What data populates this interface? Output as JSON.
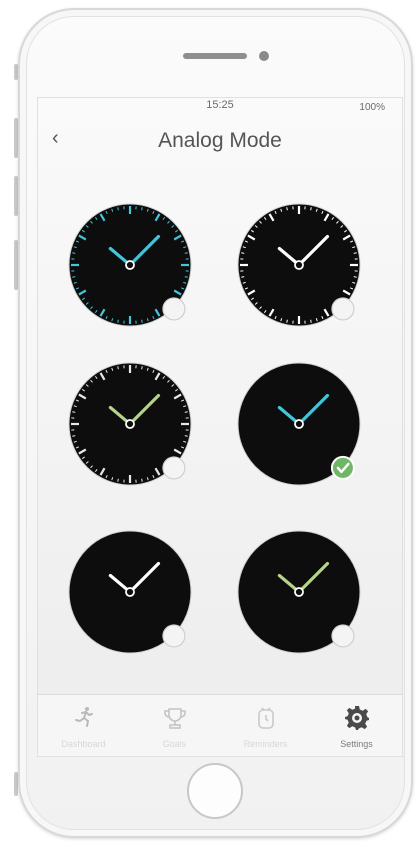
{
  "status": {
    "time": "15:25",
    "battery": "100%"
  },
  "header": {
    "back_icon": "chevron-left-icon",
    "back_glyph": "‹",
    "title": "Analog Mode"
  },
  "watch_faces": [
    {
      "name": "cyan-ticks",
      "hand_color": "#43c6dc",
      "tick_color": "#43c6dc",
      "ticks": true,
      "selected": false
    },
    {
      "name": "white-ticks",
      "hand_color": "#ffffff",
      "tick_color": "#ffffff",
      "ticks": true,
      "selected": false
    },
    {
      "name": "lime-ticks",
      "hand_color": "#b7d28a",
      "tick_color": "#e8e8e8",
      "ticks": true,
      "selected": false
    },
    {
      "name": "cyan-plain",
      "hand_color": "#43c6dc",
      "tick_color": "",
      "ticks": false,
      "selected": true
    },
    {
      "name": "white-plain",
      "hand_color": "#ffffff",
      "tick_color": "",
      "ticks": false,
      "selected": false
    },
    {
      "name": "lime-plain",
      "hand_color": "#b7d28a",
      "tick_color": "",
      "ticks": false,
      "selected": false
    }
  ],
  "colors": {
    "selected_check": "#6fb766",
    "face": "#0d0d0d",
    "active_tab": "#7c7c7c",
    "inactive_tab": "#d7d7d7"
  },
  "tabbar": {
    "tabs": [
      {
        "label": "Dashboard",
        "icon": "running-person-icon",
        "active": false
      },
      {
        "label": "Goals",
        "icon": "trophy-icon",
        "active": false
      },
      {
        "label": "Reminders",
        "icon": "alarm-clock-icon",
        "active": false
      },
      {
        "label": "Settings",
        "icon": "gear-icon",
        "active": true
      }
    ]
  }
}
